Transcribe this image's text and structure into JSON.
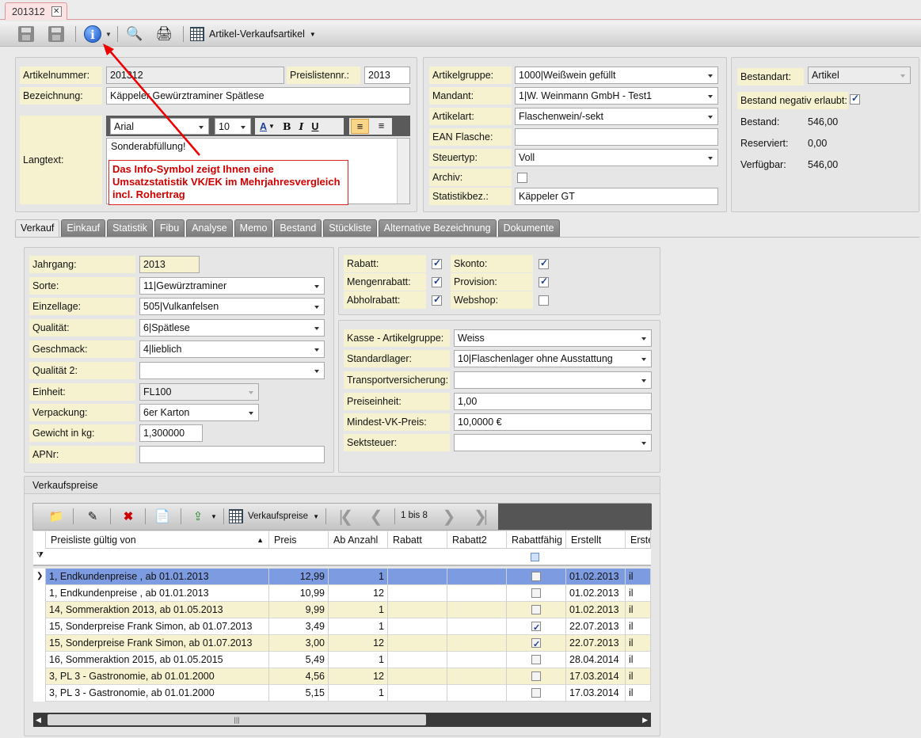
{
  "doc_tab": {
    "label": "201312",
    "close": "✕"
  },
  "toolbar": {
    "view_label": "Artikel-Verkaufsartikel"
  },
  "head_left": {
    "artikelnummer_label": "Artikelnummer:",
    "artikelnummer": "201312",
    "preisliste_label": "Preislistennr.:",
    "preisliste": "2013",
    "bezeichnung_label": "Bezeichnung:",
    "bezeichnung": "Käppeler Gewürztraminer Spätlese",
    "langtext_label": "Langtext:",
    "font": "Arial",
    "font_size": "10",
    "langtext": "Sonderabfüllung!",
    "note": "Das Info-Symbol zeigt Ihnen eine Umsatzstatistik VK/EK im Mehrjahresvergleich incl. Rohertrag"
  },
  "head_mid": {
    "artikelgruppe_label": "Artikelgruppe:",
    "artikelgruppe": "1000|Weißwein gefüllt",
    "mandant_label": "Mandant:",
    "mandant": "1|W. Weinmann GmbH - Test1",
    "artikelart_label": "Artikelart:",
    "artikelart": "Flaschenwein/-sekt",
    "ean_label": "EAN Flasche:",
    "ean": "",
    "steuertyp_label": "Steuertyp:",
    "steuertyp": "Voll",
    "archiv_label": "Archiv:",
    "statistik_label": "Statistikbez.:",
    "statistik": "Käppeler GT"
  },
  "head_right": {
    "bestandart_label": "Bestandart:",
    "bestandart": "Artikel",
    "negativ_label": "Bestand negativ erlaubt:",
    "bestand_label": "Bestand:",
    "bestand": "546,00",
    "reserviert_label": "Reserviert:",
    "reserviert": "0,00",
    "verfuegbar_label": "Verfügbar:",
    "verfuegbar": "546,00"
  },
  "tabs": [
    "Verkauf",
    "Einkauf",
    "Statistik",
    "Fibu",
    "Analyse",
    "Memo",
    "Bestand",
    "Stückliste",
    "Alternative Bezeichnung",
    "Dokumente"
  ],
  "verkauf": {
    "jahrgang_label": "Jahrgang:",
    "jahrgang": "2013",
    "sorte_label": "Sorte:",
    "sorte": "11|Gewürztraminer",
    "einzellage_label": "Einzellage:",
    "einzellage": "505|Vulkanfelsen",
    "qualitaet_label": "Qualität:",
    "qualitaet": "6|Spätlese",
    "geschmack_label": "Geschmack:",
    "geschmack": "4|lieblich",
    "qualitaet2_label": "Qualität 2:",
    "qualitaet2": "",
    "einheit_label": "Einheit:",
    "einheit": "FL100",
    "verpackung_label": "Verpackung:",
    "verpackung": "6er Karton",
    "gewicht_label": "Gewicht in kg:",
    "gewicht": "1,300000",
    "apnr_label": "APNr:",
    "apnr": ""
  },
  "flags": {
    "rabatt": "Rabatt:",
    "mengenrabatt": "Mengenrabatt:",
    "abholrabatt": "Abholrabatt:",
    "skonto": "Skonto:",
    "provision": "Provision:",
    "webshop": "Webshop:"
  },
  "kasse": {
    "artikelgruppe_label": "Kasse - Artikelgruppe:",
    "artikelgruppe": "Weiss",
    "standardlager_label": "Standardlager:",
    "standardlager": "10|Flaschenlager ohne Ausstattung",
    "transport_label": "Transportversicherung:",
    "transport": "",
    "preiseinheit_label": "Preiseinheit:",
    "preiseinheit": "1,00",
    "mindest_label": "Mindest-VK-Preis:",
    "mindest": "10,0000 €",
    "sektsteuer_label": "Sektsteuer:",
    "sektsteuer": ""
  },
  "preise": {
    "title": "Verkaufspreise",
    "view_label": "Verkaufspreise",
    "pager": "1 bis 8",
    "columns": [
      "Preisliste gültig von",
      "Preis",
      "Ab Anzahl",
      "Rabatt",
      "Rabatt2",
      "Rabattfähig",
      "Erstellt",
      "Erste"
    ],
    "rows": [
      {
        "name": "1, Endkundenpreise , ab 01.01.2013",
        "preis": "12,99",
        "anzahl": "1",
        "rf": false,
        "erstellt": "01.02.2013",
        "user": "il"
      },
      {
        "name": "1, Endkundenpreise , ab 01.01.2013",
        "preis": "10,99",
        "anzahl": "12",
        "rf": false,
        "erstellt": "01.02.2013",
        "user": "il"
      },
      {
        "name": "14, Sommeraktion 2013, ab 01.05.2013",
        "preis": "9,99",
        "anzahl": "1",
        "rf": false,
        "erstellt": "01.02.2013",
        "user": "il"
      },
      {
        "name": "15, Sonderpreise Frank Simon, ab 01.07.2013",
        "preis": "3,49",
        "anzahl": "1",
        "rf": true,
        "erstellt": "22.07.2013",
        "user": "il"
      },
      {
        "name": "15, Sonderpreise Frank Simon, ab 01.07.2013",
        "preis": "3,00",
        "anzahl": "12",
        "rf": true,
        "erstellt": "22.07.2013",
        "user": "il"
      },
      {
        "name": "16, Sommeraktion 2015, ab 01.05.2015",
        "preis": "5,49",
        "anzahl": "1",
        "rf": false,
        "erstellt": "28.04.2014",
        "user": "il"
      },
      {
        "name": "3, PL 3 - Gastronomie, ab 01.01.2000",
        "preis": "4,56",
        "anzahl": "12",
        "rf": false,
        "erstellt": "17.03.2014",
        "user": "il"
      },
      {
        "name": "3, PL 3 - Gastronomie, ab 01.01.2000",
        "preis": "5,15",
        "anzahl": "1",
        "rf": false,
        "erstellt": "17.03.2014",
        "user": "il"
      }
    ]
  }
}
